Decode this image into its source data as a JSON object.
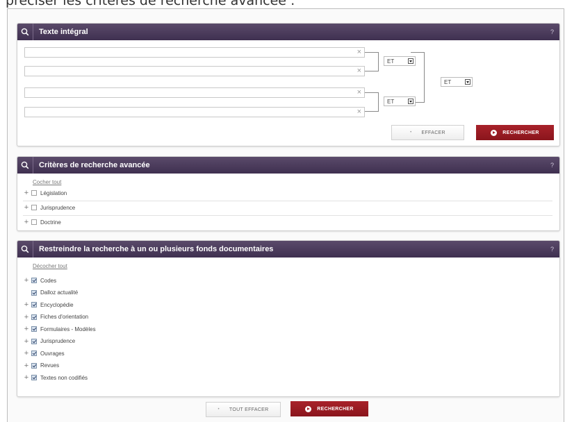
{
  "intro_text": "préciser les critères de recherche avancée :",
  "panel_text": {
    "title": "Texte intégral",
    "help": "?",
    "fields": [
      {
        "value": "",
        "clear": "×"
      },
      {
        "value": "",
        "clear": "×"
      },
      {
        "value": "",
        "clear": "×"
      },
      {
        "value": "",
        "clear": "×"
      }
    ],
    "operators": {
      "top": "ET",
      "middle": "ET",
      "bottom": "ET"
    },
    "clear_label": "EFFACER",
    "search_label": "RECHERCHER"
  },
  "panel_criteria": {
    "title": "Critères de recherche avancée",
    "help": "?",
    "toggle_all": "Cocher tout",
    "items": [
      {
        "label": "Législation",
        "checked": false
      },
      {
        "label": "Jurisprudence",
        "checked": false
      },
      {
        "label": "Doctrine",
        "checked": false
      }
    ]
  },
  "panel_funds": {
    "title": "Restreindre la recherche à un ou plusieurs fonds documentaires",
    "help": "?",
    "toggle_all": "Décocher tout",
    "items": [
      {
        "label": "Codes",
        "checked": true,
        "expandable": true
      },
      {
        "label": "Dalloz actualité",
        "checked": true,
        "expandable": false
      },
      {
        "label": "Encyclopédie",
        "checked": true,
        "expandable": true
      },
      {
        "label": "Fiches d'orientation",
        "checked": true,
        "expandable": true
      },
      {
        "label": "Formulaires - Modèles",
        "checked": true,
        "expandable": true
      },
      {
        "label": "Jurisprudence",
        "checked": true,
        "expandable": true
      },
      {
        "label": "Ouvrages",
        "checked": true,
        "expandable": true
      },
      {
        "label": "Revues",
        "checked": true,
        "expandable": true
      },
      {
        "label": "Textes non codifiés",
        "checked": true,
        "expandable": true
      }
    ]
  },
  "footer": {
    "clear_all_label": "TOUT EFFACER",
    "search_label": "RECHERCHER"
  },
  "colors": {
    "header": "#4a3a5a",
    "search_button": "#a01c24"
  },
  "icons": {
    "header": "search-icon",
    "expand": "plus-icon",
    "clear_field": "close-icon",
    "search_button": "play-circle-icon"
  }
}
